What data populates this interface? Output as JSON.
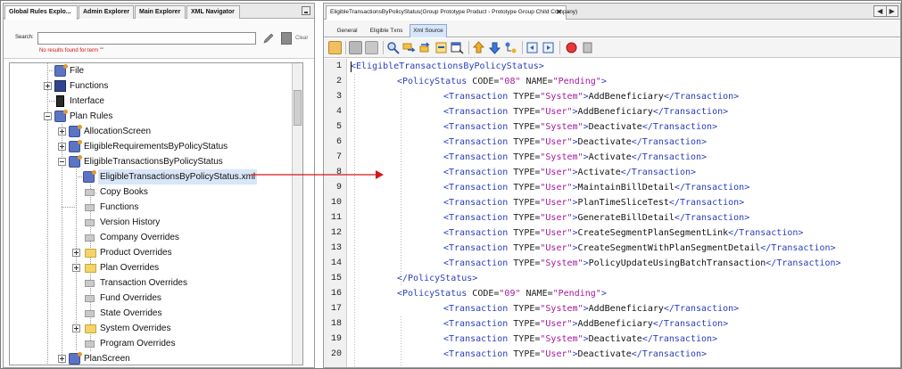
{
  "left_tabs": [
    {
      "label": "Global Rules Explo...",
      "active": true
    },
    {
      "label": "Admin Explorer",
      "active": false
    },
    {
      "label": "Main Explorer",
      "active": false
    },
    {
      "label": "XML Navigator",
      "active": false
    }
  ],
  "search": {
    "label": "Search:",
    "value": "",
    "message": "No results found for term \"\"",
    "clear_label": "Clear"
  },
  "tree": [
    {
      "label": "File",
      "icon": "rule-icon"
    },
    {
      "label": "Functions",
      "icon": "functions-icon"
    },
    {
      "label": "Interface",
      "icon": "interface-icon"
    },
    {
      "label": "Plan Rules",
      "icon": "rule-icon"
    },
    {
      "label": "AllocationScreen",
      "icon": "rule-icon"
    },
    {
      "label": "EligibleRequirementsByPolicyStatus",
      "icon": "rule-icon"
    },
    {
      "label": "EligibleTransactionsByPolicyStatus",
      "icon": "rule-icon"
    },
    {
      "label": "EligibleTransactionsByPolicyStatus.xml",
      "icon": "xml-rule-icon"
    },
    {
      "label": "Copy Books",
      "icon": "document-icon"
    },
    {
      "label": "Functions",
      "icon": "document-icon"
    },
    {
      "label": "Version History",
      "icon": "document-icon"
    },
    {
      "label": "Company Overrides",
      "icon": "document-icon"
    },
    {
      "label": "Product Overrides",
      "icon": "folder-icon"
    },
    {
      "label": "Plan Overrides",
      "icon": "folder-icon"
    },
    {
      "label": "Transaction Overrides",
      "icon": "document-icon"
    },
    {
      "label": "Fund Overrides",
      "icon": "document-icon"
    },
    {
      "label": "State Overrides",
      "icon": "document-icon"
    },
    {
      "label": "System Overrides",
      "icon": "folder-icon"
    },
    {
      "label": "Program Overrides",
      "icon": "document-icon"
    },
    {
      "label": "PlanScreen",
      "icon": "rule-icon"
    }
  ],
  "doc_tab": {
    "title": "EligibleTransactionsByPolicyStatus(Group Prototype Product - Prototype Group Child Company)",
    "close": "✕"
  },
  "nav": {
    "prev": "◀",
    "next": "▶"
  },
  "sub_tabs": [
    {
      "label": "General",
      "active": false
    },
    {
      "label": "Eligible Txns",
      "active": false
    },
    {
      "label": "Xml Source",
      "active": true
    }
  ],
  "colors": {
    "tag": "#2a3fb8",
    "value": "#a3189b",
    "selection": "#d8e6f7",
    "arrow": "#d11a1a"
  },
  "code_lines": [
    {
      "n": "1",
      "indent": 0,
      "parts": [
        [
          "tag",
          "<EligibleTransactionsByPolicyStatus>"
        ]
      ]
    },
    {
      "n": "2",
      "indent": 1,
      "parts": [
        [
          "tag",
          "<PolicyStatus "
        ],
        [
          "attr",
          "CODE="
        ],
        [
          "val",
          "\"08\""
        ],
        [
          "attr",
          " NAME="
        ],
        [
          "val",
          "\"Pending\""
        ],
        [
          "tag",
          ">"
        ]
      ]
    },
    {
      "n": "3",
      "indent": 2,
      "parts": [
        [
          "tag",
          "<Transaction "
        ],
        [
          "attr",
          "TYPE="
        ],
        [
          "val",
          "\"System\""
        ],
        [
          "tag",
          ">"
        ],
        [
          "txt",
          "AddBeneficiary"
        ],
        [
          "tag",
          "</Transaction>"
        ]
      ]
    },
    {
      "n": "4",
      "indent": 2,
      "parts": [
        [
          "tag",
          "<Transaction "
        ],
        [
          "attr",
          "TYPE="
        ],
        [
          "val",
          "\"User\""
        ],
        [
          "tag",
          ">"
        ],
        [
          "txt",
          "AddBeneficiary"
        ],
        [
          "tag",
          "</Transaction>"
        ]
      ]
    },
    {
      "n": "5",
      "indent": 2,
      "parts": [
        [
          "tag",
          "<Transaction "
        ],
        [
          "attr",
          "TYPE="
        ],
        [
          "val",
          "\"System\""
        ],
        [
          "tag",
          ">"
        ],
        [
          "txt",
          "Deactivate"
        ],
        [
          "tag",
          "</Transaction>"
        ]
      ]
    },
    {
      "n": "6",
      "indent": 2,
      "parts": [
        [
          "tag",
          "<Transaction "
        ],
        [
          "attr",
          "TYPE="
        ],
        [
          "val",
          "\"User\""
        ],
        [
          "tag",
          ">"
        ],
        [
          "txt",
          "Deactivate"
        ],
        [
          "tag",
          "</Transaction>"
        ]
      ]
    },
    {
      "n": "7",
      "indent": 2,
      "parts": [
        [
          "tag",
          "<Transaction "
        ],
        [
          "attr",
          "TYPE="
        ],
        [
          "val",
          "\"System\""
        ],
        [
          "tag",
          ">"
        ],
        [
          "txt",
          "Activate"
        ],
        [
          "tag",
          "</Transaction>"
        ]
      ]
    },
    {
      "n": "8",
      "indent": 2,
      "parts": [
        [
          "tag",
          "<Transaction "
        ],
        [
          "attr",
          "TYPE="
        ],
        [
          "val",
          "\"User\""
        ],
        [
          "tag",
          ">"
        ],
        [
          "txt",
          "Activate"
        ],
        [
          "tag",
          "</Transaction>"
        ]
      ]
    },
    {
      "n": "9",
      "indent": 2,
      "parts": [
        [
          "tag",
          "<Transaction "
        ],
        [
          "attr",
          "TYPE="
        ],
        [
          "val",
          "\"User\""
        ],
        [
          "tag",
          ">"
        ],
        [
          "txt",
          "MaintainBillDetail"
        ],
        [
          "tag",
          "</Transaction>"
        ]
      ]
    },
    {
      "n": "10",
      "indent": 2,
      "parts": [
        [
          "tag",
          "<Transaction "
        ],
        [
          "attr",
          "TYPE="
        ],
        [
          "val",
          "\"User\""
        ],
        [
          "tag",
          ">"
        ],
        [
          "txt",
          "PlanTimeSliceTest"
        ],
        [
          "tag",
          "</Transaction>"
        ]
      ]
    },
    {
      "n": "11",
      "indent": 2,
      "parts": [
        [
          "tag",
          "<Transaction "
        ],
        [
          "attr",
          "TYPE="
        ],
        [
          "val",
          "\"User\""
        ],
        [
          "tag",
          ">"
        ],
        [
          "txt",
          "GenerateBillDetail"
        ],
        [
          "tag",
          "</Transaction>"
        ]
      ]
    },
    {
      "n": "12",
      "indent": 2,
      "parts": [
        [
          "tag",
          "<Transaction "
        ],
        [
          "attr",
          "TYPE="
        ],
        [
          "val",
          "\"User\""
        ],
        [
          "tag",
          ">"
        ],
        [
          "txt",
          "CreateSegmentPlanSegmentLink"
        ],
        [
          "tag",
          "</Transaction>"
        ]
      ]
    },
    {
      "n": "13",
      "indent": 2,
      "parts": [
        [
          "tag",
          "<Transaction "
        ],
        [
          "attr",
          "TYPE="
        ],
        [
          "val",
          "\"User\""
        ],
        [
          "tag",
          ">"
        ],
        [
          "txt",
          "CreateSegmentWithPlanSegmentDetail"
        ],
        [
          "tag",
          "</Transaction>"
        ]
      ]
    },
    {
      "n": "14",
      "indent": 2,
      "parts": [
        [
          "tag",
          "<Transaction "
        ],
        [
          "attr",
          "TYPE="
        ],
        [
          "val",
          "\"System\""
        ],
        [
          "tag",
          ">"
        ],
        [
          "txt",
          "PolicyUpdateUsingBatchTransaction"
        ],
        [
          "tag",
          "</Transaction>"
        ]
      ]
    },
    {
      "n": "15",
      "indent": 1,
      "parts": [
        [
          "tag",
          "</PolicyStatus>"
        ]
      ]
    },
    {
      "n": "16",
      "indent": 1,
      "parts": [
        [
          "tag",
          "<PolicyStatus "
        ],
        [
          "attr",
          "CODE="
        ],
        [
          "val",
          "\"09\""
        ],
        [
          "attr",
          " NAME="
        ],
        [
          "val",
          "\"Pending\""
        ],
        [
          "tag",
          ">"
        ]
      ]
    },
    {
      "n": "17",
      "indent": 2,
      "parts": [
        [
          "tag",
          "<Transaction "
        ],
        [
          "attr",
          "TYPE="
        ],
        [
          "val",
          "\"System\""
        ],
        [
          "tag",
          ">"
        ],
        [
          "txt",
          "AddBeneficiary"
        ],
        [
          "tag",
          "</Transaction>"
        ]
      ]
    },
    {
      "n": "18",
      "indent": 2,
      "parts": [
        [
          "tag",
          "<Transaction "
        ],
        [
          "attr",
          "TYPE="
        ],
        [
          "val",
          "\"User\""
        ],
        [
          "tag",
          ">"
        ],
        [
          "txt",
          "AddBeneficiary"
        ],
        [
          "tag",
          "</Transaction>"
        ]
      ]
    },
    {
      "n": "19",
      "indent": 2,
      "parts": [
        [
          "tag",
          "<Transaction "
        ],
        [
          "attr",
          "TYPE="
        ],
        [
          "val",
          "\"System\""
        ],
        [
          "tag",
          ">"
        ],
        [
          "txt",
          "Deactivate"
        ],
        [
          "tag",
          "</Transaction>"
        ]
      ]
    },
    {
      "n": "20",
      "indent": 2,
      "parts": [
        [
          "tag",
          "<Transaction "
        ],
        [
          "attr",
          "TYPE="
        ],
        [
          "val",
          "\"User\""
        ],
        [
          "tag",
          ">"
        ],
        [
          "txt",
          "Deactivate"
        ],
        [
          "tag",
          "</Transaction>"
        ]
      ]
    }
  ]
}
